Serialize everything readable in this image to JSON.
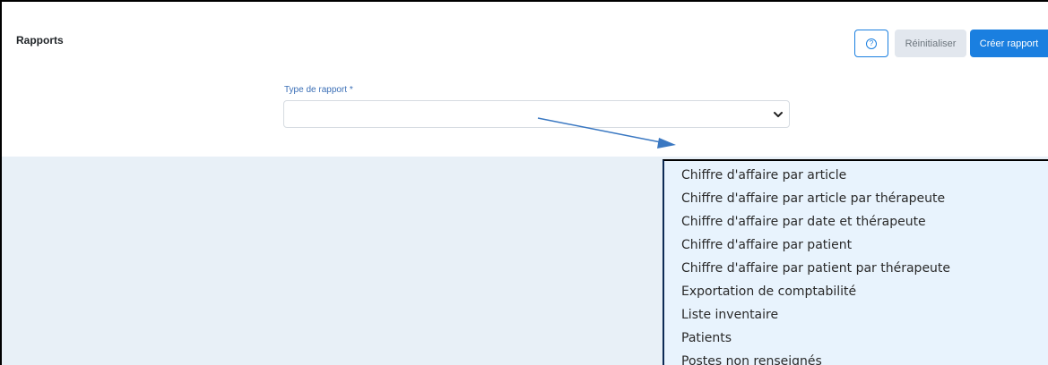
{
  "header": {
    "title": "Rapports",
    "help_icon": "question-circle-icon",
    "reset_label": "Réinitialiser",
    "create_label": "Créer rapport"
  },
  "form": {
    "report_type_label": "Type de rapport *",
    "report_type_value": ""
  },
  "dropdown": {
    "options": [
      "Chiffre d'affaire par article",
      "Chiffre d'affaire par article par thérapeute",
      "Chiffre d'affaire par date et thérapeute",
      "Chiffre d'affaire par patient",
      "Chiffre d'affaire par patient par thérapeute",
      "Exportation de comptabilité",
      "Liste inventaire",
      "Patients",
      "Postes non renseignés"
    ]
  },
  "colors": {
    "accent": "#1a7fe0",
    "annotation_arrow": "#3a78c2",
    "dropdown_background": "#e8f3fd",
    "page_background": "#e8f0f7"
  }
}
